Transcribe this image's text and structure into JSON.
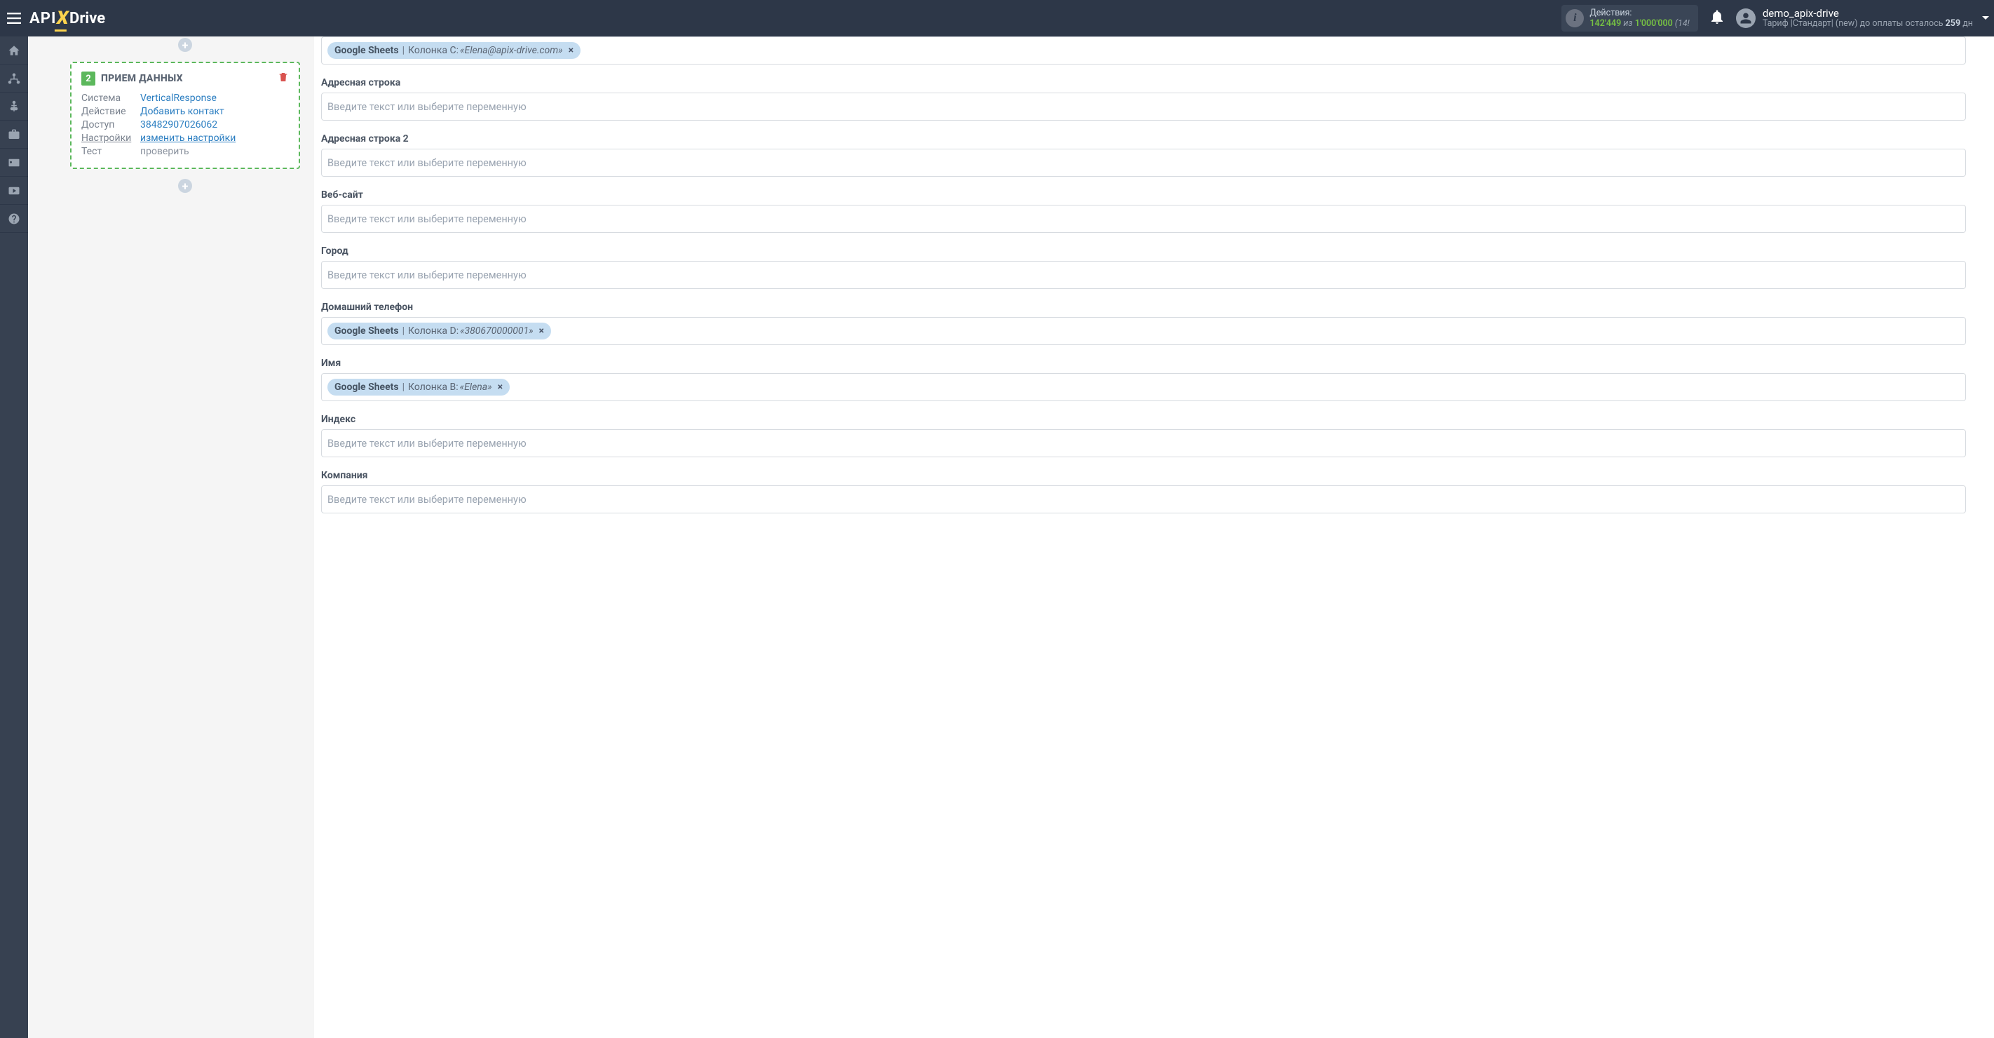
{
  "header": {
    "logo": {
      "pre": "API",
      "mid": "X",
      "post": "Drive"
    },
    "actions": {
      "label": "Действия:",
      "used": "142'449",
      "of": "из",
      "limit": "1'000'000",
      "paren": "(14!"
    },
    "user": {
      "name": "demo_apix-drive",
      "tariff_prefix": "Тариф |Стандарт| (new) до оплаты осталось ",
      "days": "259",
      "tariff_suffix": " дн"
    }
  },
  "node": {
    "badge": "2",
    "title": "ПРИЕМ ДАННЫХ",
    "rows": {
      "system_k": "Система",
      "system_v": "VerticalResponse",
      "action_k": "Действие",
      "action_v": "Добавить контакт",
      "access_k": "Доступ",
      "access_v": "38482907026062",
      "settings_k": "Настройки",
      "settings_v": "изменить настройки",
      "test_k": "Тест",
      "test_v": "проверить"
    }
  },
  "fields": [
    {
      "label": "",
      "tag": {
        "source": "Google Sheets",
        "column": "Колонка C:",
        "value": "«Elena@apix-drive.com»"
      }
    },
    {
      "label": "Адресная строка",
      "placeholder": "Введите текст или выберите переменную"
    },
    {
      "label": "Адресная строка 2",
      "placeholder": "Введите текст или выберите переменную"
    },
    {
      "label": "Веб-сайт",
      "placeholder": "Введите текст или выберите переменную"
    },
    {
      "label": "Город",
      "placeholder": "Введите текст или выберите переменную"
    },
    {
      "label": "Домашний телефон",
      "tag": {
        "source": "Google Sheets",
        "column": "Колонка D:",
        "value": "«380670000001»"
      }
    },
    {
      "label": "Имя",
      "tag": {
        "source": "Google Sheets",
        "column": "Колонка B:",
        "value": "«Elena»"
      }
    },
    {
      "label": "Индекс",
      "placeholder": "Введите текст или выберите переменную"
    },
    {
      "label": "Компания",
      "placeholder": "Введите текст или выберите переменную"
    }
  ]
}
